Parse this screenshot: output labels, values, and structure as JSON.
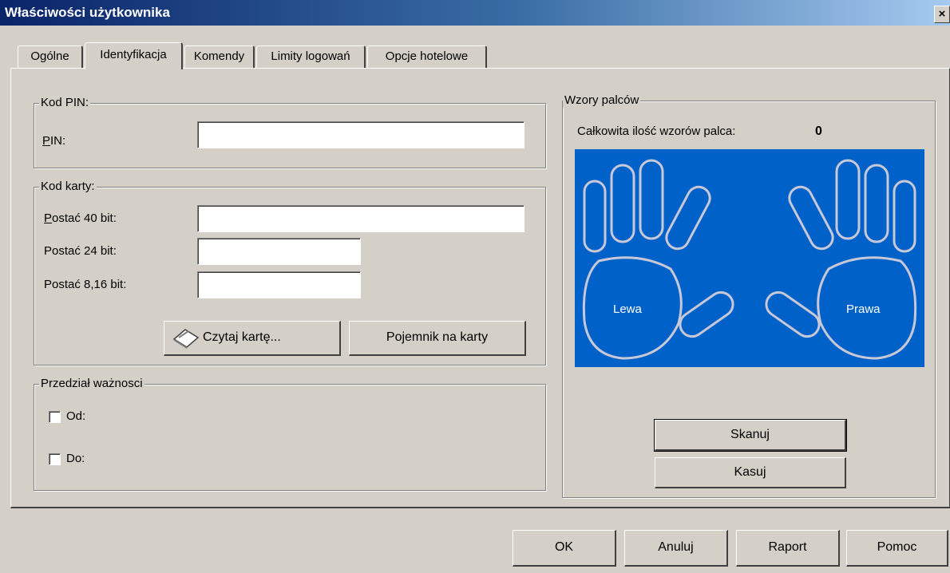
{
  "window": {
    "title": "Właściwości użytkownika",
    "close_label": "×"
  },
  "tabs": [
    {
      "label": "Ogólne"
    },
    {
      "label": "Identyfikacja"
    },
    {
      "label": "Komendy"
    },
    {
      "label": "Limity logowań"
    },
    {
      "label": "Opcje hotelowe"
    }
  ],
  "active_tab": "Identyfikacja",
  "pin_group": {
    "legend": "Kod PIN:",
    "pin_label_accel": "P",
    "pin_label_rest": "IN:",
    "pin_value": ""
  },
  "card_group": {
    "legend": "Kod karty:",
    "f40_label_accel": "P",
    "f40_label_rest": "ostać 40 bit:",
    "f40_value": "",
    "f24_label": "Postać 24 bit:",
    "f24_value": "",
    "f816_label": "Postać 8,16 bit:",
    "f816_value": "",
    "read_card_button": "Czytaj kartę...",
    "card_container_button": "Pojemnik na karty"
  },
  "validity_group": {
    "legend": "Przedział ważnosci",
    "from_label": "Od:",
    "from_checked": false,
    "to_label": "Do:",
    "to_checked": false
  },
  "finger_group": {
    "legend": "Wzory palców",
    "total_label": "Całkowita ilość wzorów palca:",
    "total_count": "0",
    "left_hand_label": "Lewa",
    "right_hand_label": "Prawa",
    "hands_background": "#0062c8",
    "scan_button": "Skanuj",
    "delete_button": "Kasuj"
  },
  "footer": {
    "ok_button": "OK",
    "cancel_button": "Anuluj",
    "report_button": "Raport",
    "help_button": "Pomoc"
  }
}
